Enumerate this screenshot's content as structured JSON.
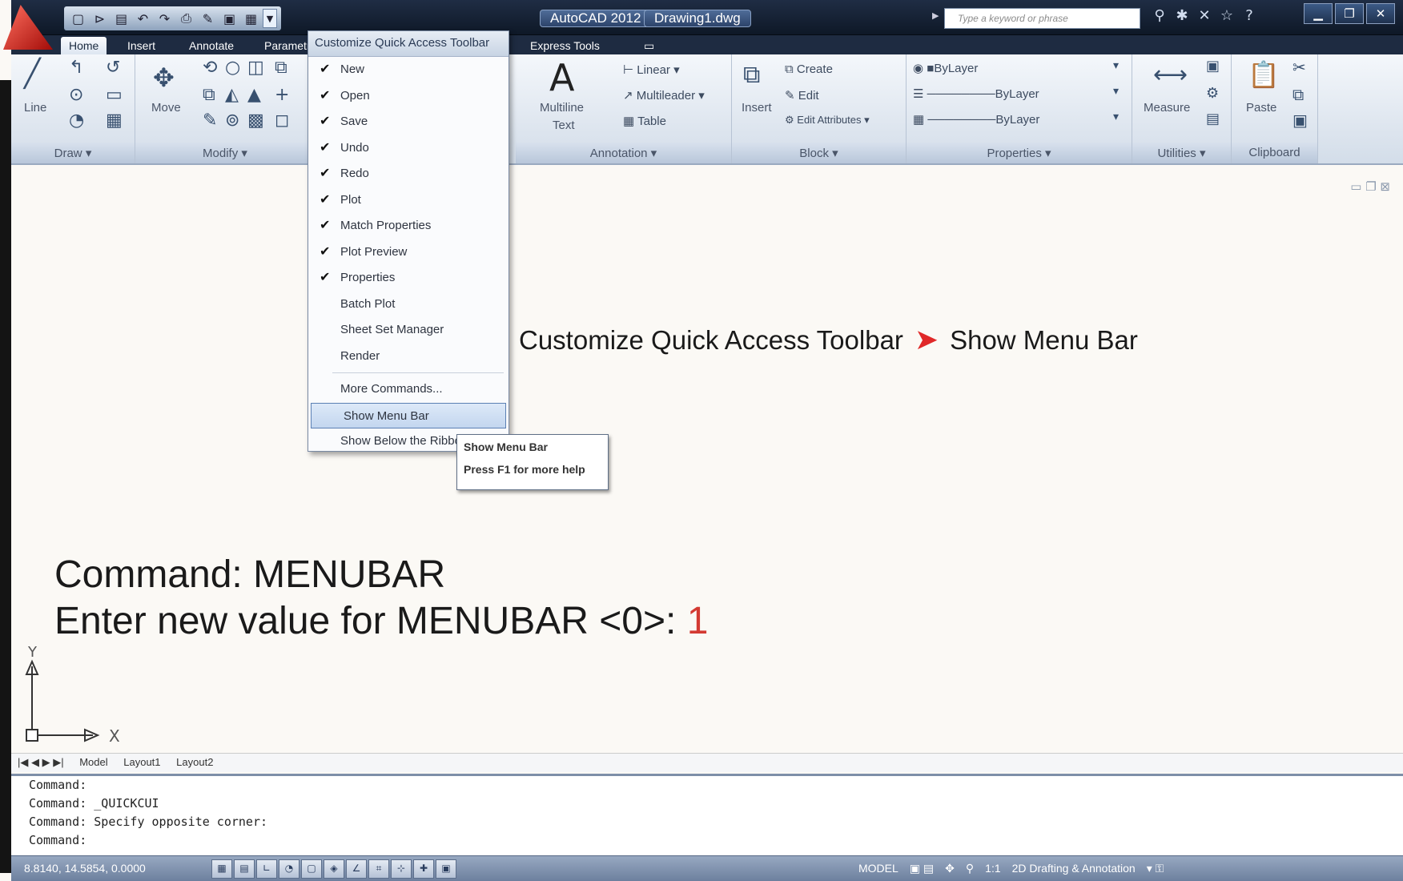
{
  "app": {
    "name": "AutoCAD 2012",
    "file": "Drawing1.dwg",
    "search_placeholder": "Type a keyword or phrase"
  },
  "tabs": [
    "Home",
    "Insert",
    "Annotate",
    "Parametric",
    "Express Tools"
  ],
  "ribbon": {
    "draw": {
      "title": "Draw",
      "line": "Line"
    },
    "modify": {
      "title": "Modify",
      "move": "Move"
    },
    "annotation": {
      "title": "Annotation",
      "mtext_1": "Multiline",
      "mtext_2": "Text",
      "linear": "Linear",
      "multileader": "Multileader",
      "table": "Table"
    },
    "block": {
      "title": "Block",
      "insert": "Insert",
      "create": "Create",
      "edit": "Edit",
      "edit_attributes": "Edit Attributes"
    },
    "properties": {
      "title": "Properties",
      "color": "ByLayer",
      "linetype": "ByLayer",
      "lineweight": "ByLayer"
    },
    "utilities": {
      "title": "Utilities",
      "measure": "Measure"
    },
    "clipboard": {
      "title": "Clipboard",
      "paste": "Paste"
    }
  },
  "qat_menu": {
    "title": "Customize Quick Access Toolbar",
    "items": [
      {
        "label": "New",
        "checked": "✔"
      },
      {
        "label": "Open",
        "checked": "✔"
      },
      {
        "label": "Save",
        "checked": "✔"
      },
      {
        "label": "Undo",
        "checked": "✔"
      },
      {
        "label": "Redo",
        "checked": "✔"
      },
      {
        "label": "Plot",
        "checked": "✔"
      },
      {
        "label": "Match Properties",
        "checked": "✔"
      },
      {
        "label": "Plot Preview",
        "checked": "✔"
      },
      {
        "label": "Properties",
        "checked": "✔"
      },
      {
        "label": "Batch Plot",
        "checked": ""
      },
      {
        "label": "Sheet Set Manager",
        "checked": ""
      },
      {
        "label": "Render",
        "checked": ""
      }
    ],
    "more": "More Commands...",
    "show_menu_bar": "Show Menu Bar",
    "show_below": "Show Below the Ribbon"
  },
  "tooltip": {
    "title": "Show Menu Bar",
    "help": "Press F1 for more help"
  },
  "annotation": {
    "left": "Customize Quick Access Toolbar",
    "arrow": "➤",
    "right": "Show Menu Bar"
  },
  "command_overlay": {
    "line1": "Command:  MENUBAR",
    "line2": "Enter new value for MENUBAR <0>: ",
    "value": "1"
  },
  "ucs": {
    "x": "X",
    "y": "Y"
  },
  "layout_tabs": [
    "Model",
    "Layout1",
    "Layout2"
  ],
  "command_window": [
    "Command:",
    "Command: _QUICKCUI",
    "Command: Specify opposite corner:",
    "Command:"
  ],
  "status": {
    "coords": "8.8140, 14.5854, 0.0000",
    "model": "MODEL",
    "scale": "1:1",
    "workspace": "2D Drafting & Annotation"
  }
}
